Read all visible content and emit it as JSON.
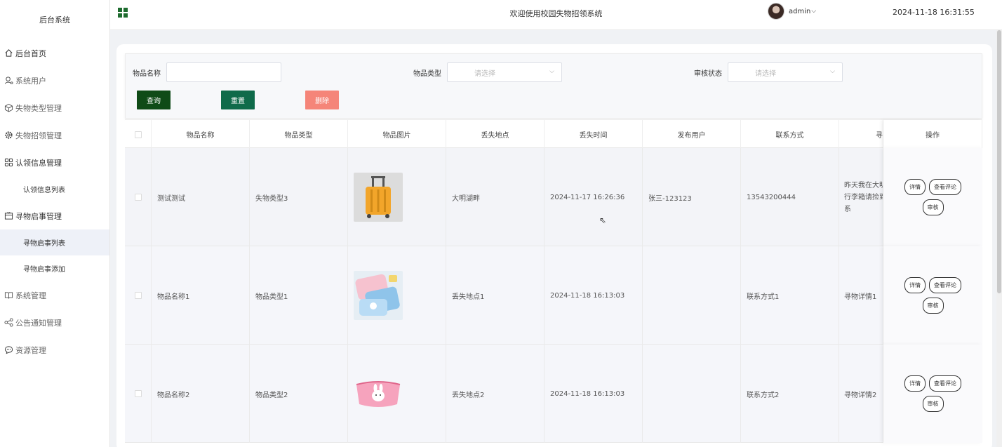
{
  "sidebar": {
    "brand": "后台系统",
    "items": [
      {
        "label": "后台首页",
        "icon": "home-icon"
      },
      {
        "label": "系统用户",
        "icon": "user-icon"
      },
      {
        "label": "失物类型管理",
        "icon": "cube-icon"
      },
      {
        "label": "失物招领管理",
        "icon": "gear-icon"
      },
      {
        "label": "认领信息管理",
        "icon": "grid-icon"
      },
      {
        "label": "认领信息列表",
        "sub": true
      },
      {
        "label": "寻物启事管理",
        "icon": "window-icon"
      },
      {
        "label": "寻物启事列表",
        "sub": true,
        "active": true
      },
      {
        "label": "寻物启事添加",
        "sub": true
      },
      {
        "label": "系统管理",
        "icon": "book-icon"
      },
      {
        "label": "公告通知管理",
        "icon": "share-icon"
      },
      {
        "label": "资源管理",
        "icon": "chat-icon"
      }
    ]
  },
  "header": {
    "title": "欢迎使用校园失物招领系统",
    "user": "admin",
    "time": "2024-11-18 16:31:55"
  },
  "search": {
    "name_label": "物品名称",
    "type_label": "物品类型",
    "type_placeholder": "请选择",
    "status_label": "审核状态",
    "status_placeholder": "请选择",
    "query": "查询",
    "reset": "重置",
    "delete": "删除"
  },
  "colors": {
    "query": "#0f4b17",
    "reset": "#0f6b4a",
    "delete": "#f58579"
  },
  "table": {
    "headers": [
      "物品名称",
      "物品类型",
      "物品图片",
      "丢失地点",
      "丢失时间",
      "发布用户",
      "联系方式",
      "寻",
      "操作"
    ],
    "rows": [
      {
        "name": "测试测试",
        "type": "失物类型3",
        "place": "大明湖畔",
        "time": "2024-11-17 16:26:36",
        "user": "张三-123123",
        "contact": "13543200444",
        "detail": "昨天我在大明湖畔丢失了一个行李箱请捡到的同学联系"
      },
      {
        "name": "物品名称1",
        "type": "物品类型1",
        "place": "丢失地点1",
        "time": "2024-11-18 16:13:03",
        "user": "",
        "contact": "联系方式1",
        "detail": "寻物详情1"
      },
      {
        "name": "物品名称2",
        "type": "物品类型2",
        "place": "丢失地点2",
        "time": "2024-11-18 16:13:03",
        "user": "",
        "contact": "联系方式2",
        "detail": "寻物详情2"
      }
    ],
    "actions": {
      "detail": "详情",
      "comments": "查看评论",
      "review": "审核"
    },
    "row0_detail_lines": [
      "昨天我在大明",
      "行李箱请捡到",
      "系"
    ]
  }
}
